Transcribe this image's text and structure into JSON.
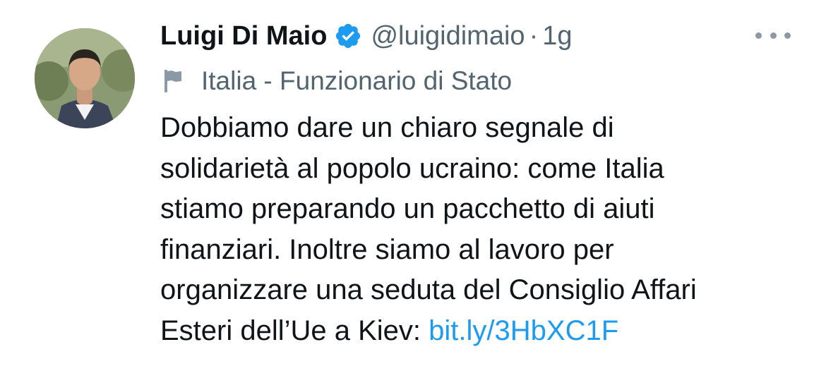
{
  "tweet": {
    "author_name": "Luigi Di Maio",
    "handle": "@luigidimaio",
    "separator": "·",
    "time": "1g",
    "label": "Italia - Funzionario di Stato",
    "text_lines": [
      "Dobbiamo dare un chiaro segnale di",
      "solidarietà al popolo ucraino: come Italia",
      "stiamo preparando un pacchetto di aiuti",
      "finanziari. Inoltre siamo al lavoro per",
      "organizzare una seduta del Consiglio Affari"
    ],
    "last_line_prefix": "Esteri dell’Ue a Kiev: ",
    "link_text": "bit.ly/3HbXC1F"
  },
  "icons": {
    "verified": "verified-badge-icon",
    "more": "more-options-icon",
    "label_flag": "flag-icon"
  },
  "colors": {
    "primary_text": "#0f1419",
    "secondary_text": "#536471",
    "link": "#1d9bf0",
    "verified_badge": "#1d9bf0"
  }
}
